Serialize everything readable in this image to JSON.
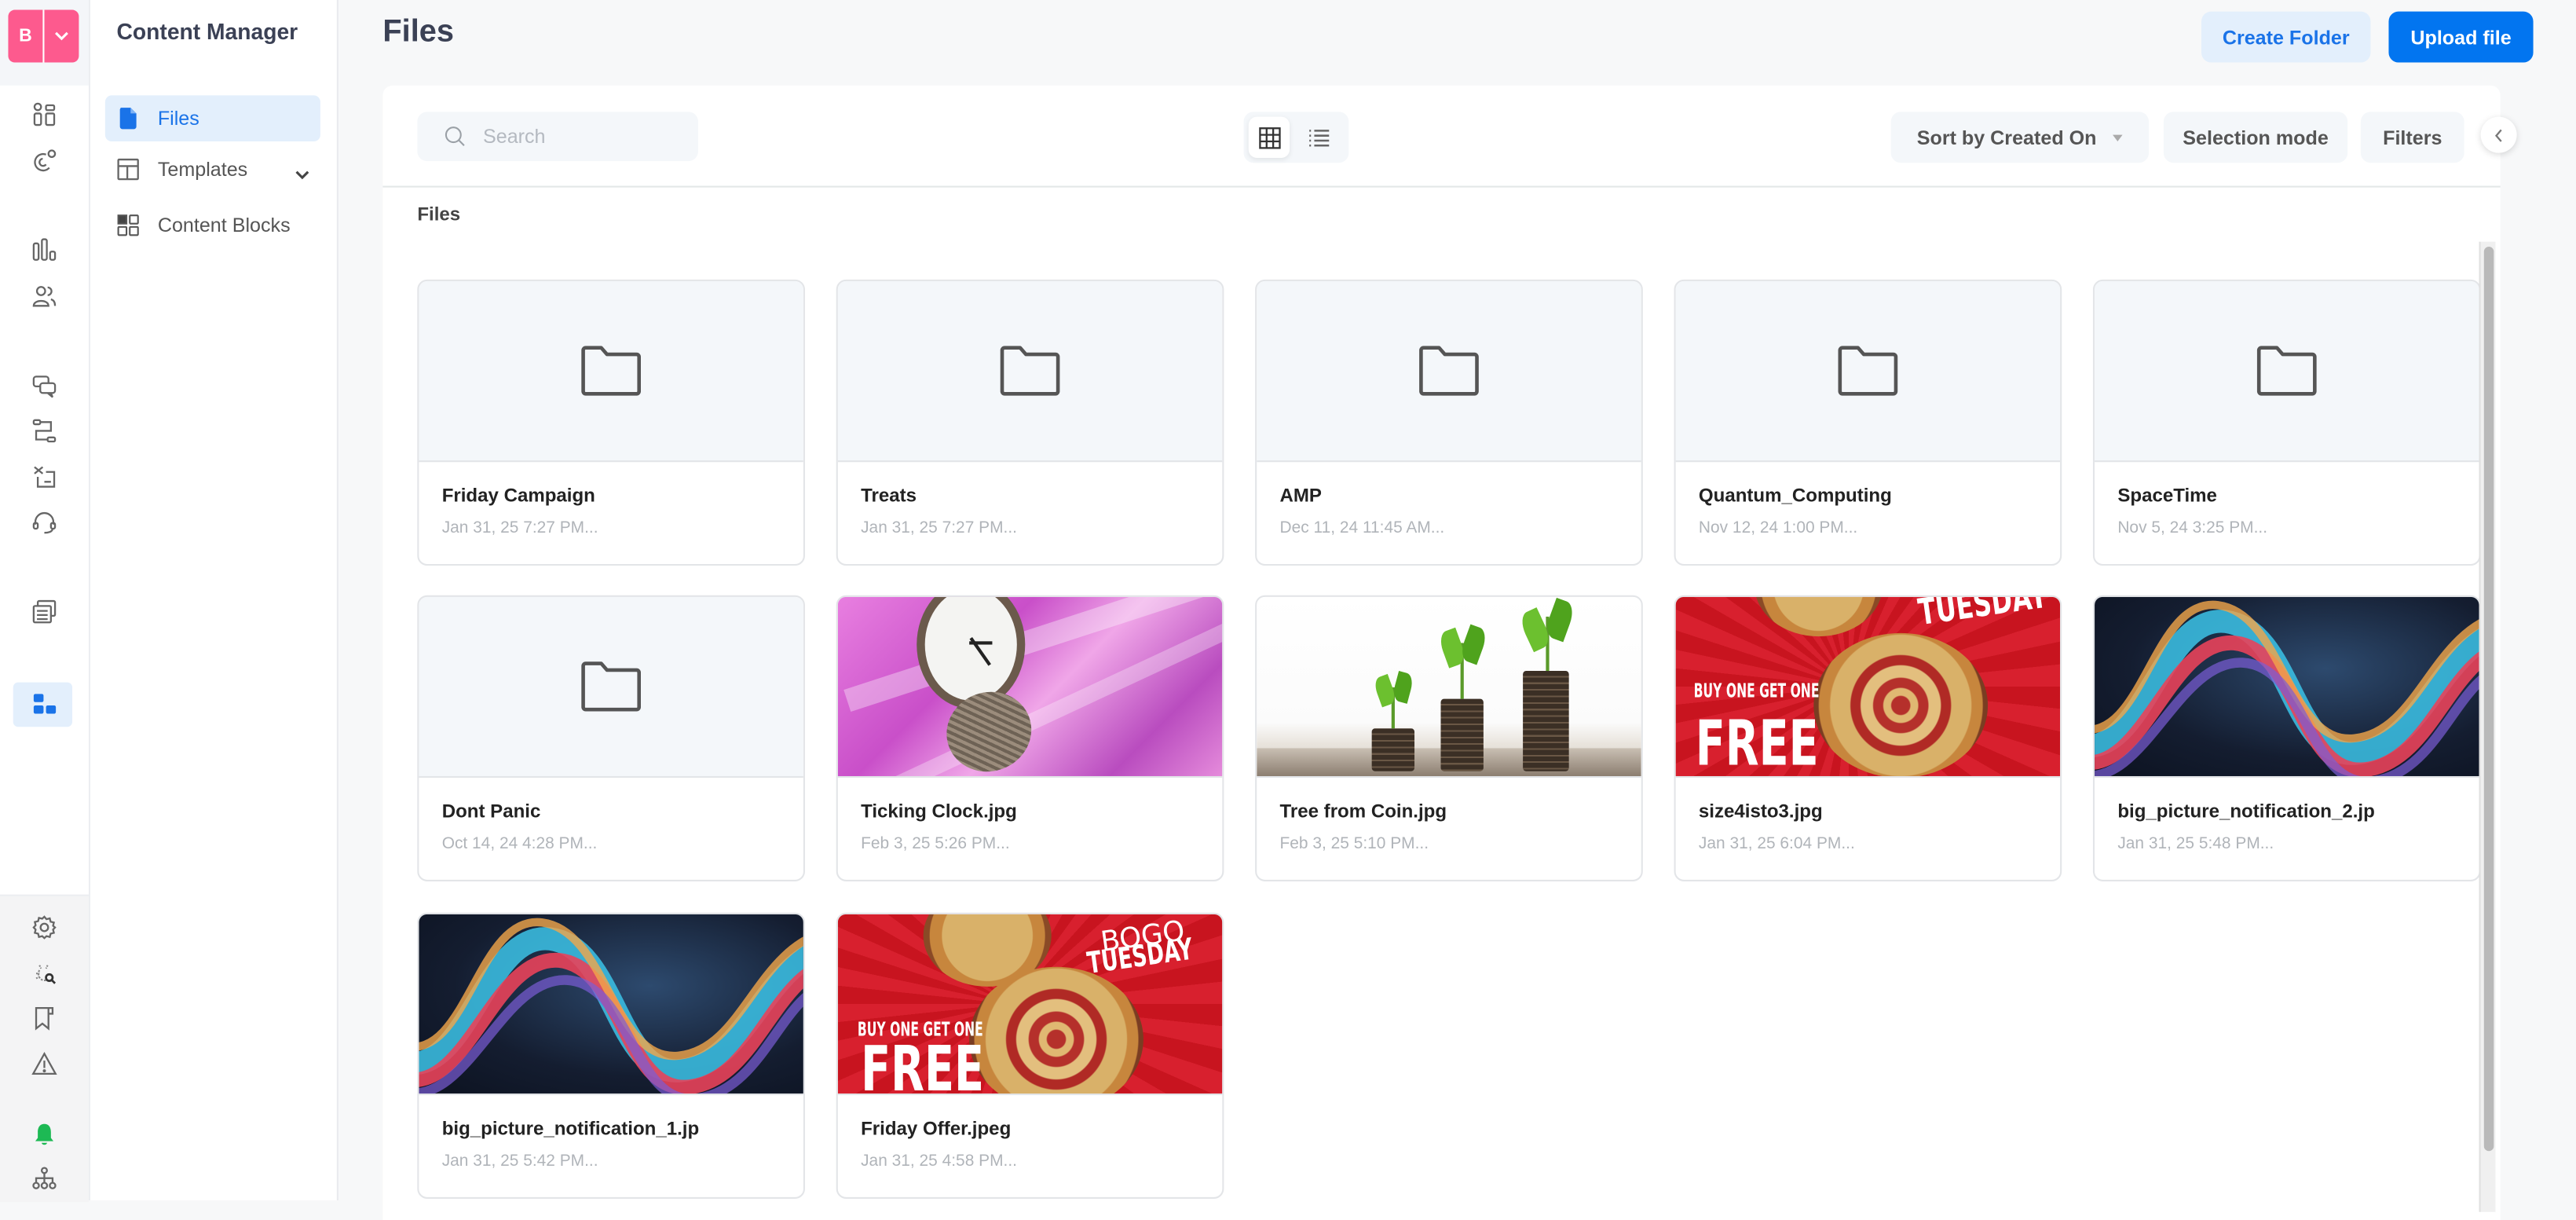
{
  "brand": {
    "initial": "B"
  },
  "rail": {
    "top_icons": [
      "dashboard-icon",
      "magnet-icon",
      "analytics-icon",
      "users-icon",
      "chat-icon",
      "flow-icon",
      "campaign-icon",
      "headset-icon",
      "templates-stack-icon",
      "content-manager-icon"
    ],
    "bottom_icons": [
      "settings-icon",
      "debug-search-icon",
      "bookmark-icon",
      "warning-icon",
      "notification-bell-icon",
      "org-tree-icon"
    ],
    "active": "content-manager-icon",
    "bell_color": "#1db954"
  },
  "nav": {
    "title": "Content Manager",
    "items": [
      {
        "label": "Files",
        "icon": "file-icon",
        "active": true
      },
      {
        "label": "Templates",
        "icon": "template-layout-icon",
        "expandable": true
      },
      {
        "label": "Content Blocks",
        "icon": "blocks-icon"
      }
    ]
  },
  "header": {
    "title": "Files",
    "create_folder_label": "Create Folder",
    "upload_file_label": "Upload file"
  },
  "toolbar": {
    "search_placeholder": "Search",
    "search_value": "",
    "view_mode": "grid",
    "sort_label": "Sort by Created On",
    "selection_mode_label": "Selection mode",
    "filters_label": "Filters"
  },
  "section_label": "Files",
  "colors": {
    "accent": "#0275f0",
    "accent_light": "#e3effc",
    "brand_pink": "#fd5a8e",
    "title_text": "#3b4155"
  },
  "items": [
    {
      "type": "folder",
      "name": "Friday Campaign",
      "date": "Jan 31, 25 7:27 PM..."
    },
    {
      "type": "folder",
      "name": "Treats",
      "date": "Jan 31, 25 7:27 PM..."
    },
    {
      "type": "folder",
      "name": "AMP",
      "date": "Dec 11, 24 11:45 AM..."
    },
    {
      "type": "folder",
      "name": "Quantum_Computing",
      "date": "Nov 12, 24 1:00 PM..."
    },
    {
      "type": "folder",
      "name": "SpaceTime",
      "date": "Nov 5, 24 3:25 PM..."
    },
    {
      "type": "folder",
      "name": "Dont Panic",
      "date": "Oct 14, 24 4:28 PM..."
    },
    {
      "type": "image",
      "thumb": "clock-money",
      "name": "Ticking Clock.jpg",
      "date": "Feb 3, 25 5:26 PM..."
    },
    {
      "type": "image",
      "thumb": "coin-plants",
      "name": "Tree from Coin.jpg",
      "date": "Feb 3, 25 5:10 PM..."
    },
    {
      "type": "image",
      "thumb": "pizza-crop",
      "name": "size4isto3.jpg",
      "date": "Jan 31, 25 6:04 PM...",
      "overlay_top": "TUESDAY",
      "overlay_small": "BUY ONE GET ONE",
      "overlay_big": "FREE"
    },
    {
      "type": "image",
      "thumb": "waves",
      "name": "big_picture_notification_2.jp",
      "date": "Jan 31, 25 5:48 PM..."
    },
    {
      "type": "image",
      "thumb": "waves",
      "name": "big_picture_notification_1.jp",
      "date": "Jan 31, 25 5:42 PM..."
    },
    {
      "type": "image",
      "thumb": "pizza-full",
      "name": "Friday Offer.jpeg",
      "date": "Jan 31, 25 4:58 PM...",
      "overlay_top": "BOGO",
      "overlay_top2": "TUESDAY",
      "overlay_small": "BUY ONE GET ONE",
      "overlay_big": "FREE"
    }
  ],
  "scroll": {
    "position_fraction": 0.0,
    "visible_fraction": 0.93
  }
}
